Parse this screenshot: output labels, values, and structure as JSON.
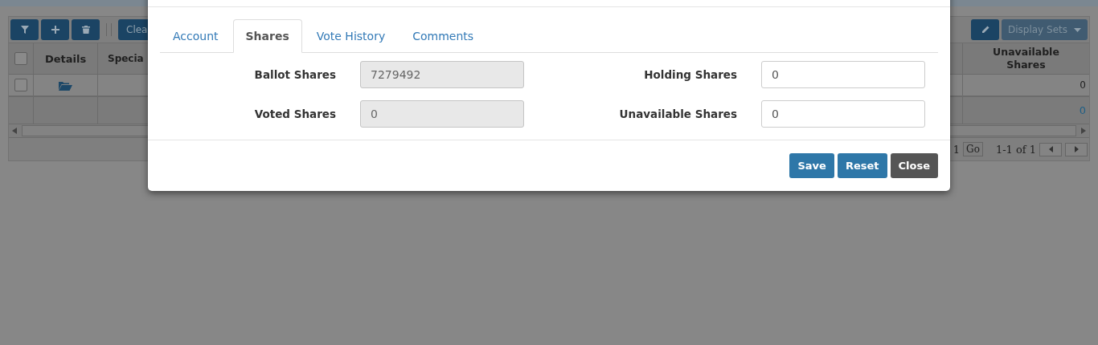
{
  "page": {
    "toolbar": {
      "icon_buttons": [
        {
          "kind": "filter"
        },
        {
          "kind": "add"
        },
        {
          "kind": "delete"
        }
      ],
      "clear_button": "Clea",
      "display_sets_button": "Display Sets"
    },
    "grid": {
      "select_all_checked": false,
      "columns": [
        "Details",
        "Specia",
        "Unavailable Shares"
      ],
      "rows": [
        {
          "checked": false,
          "unavailable_shares": "0"
        }
      ],
      "summary": {
        "unavailable_shares": "0"
      }
    },
    "pager": {
      "page": "1",
      "go_button": "Go",
      "range": "1-1 of 1"
    }
  },
  "dialog": {
    "tabs": [
      {
        "label": "Account",
        "selected": false
      },
      {
        "label": "Shares",
        "selected": true
      },
      {
        "label": "Vote History",
        "selected": false
      },
      {
        "label": "Comments",
        "selected": false
      }
    ],
    "fields": [
      {
        "label": "Ballot Shares",
        "value": "7279492",
        "disabled": true
      },
      {
        "label": "Holding Shares",
        "value": "0",
        "disabled": false
      },
      {
        "label": "Voted Shares",
        "value": "0",
        "disabled": true
      },
      {
        "label": "Unavailable Shares",
        "value": "0",
        "disabled": false
      }
    ],
    "buttons": [
      {
        "label": "Save",
        "kind": "primary"
      },
      {
        "label": "Reset",
        "kind": "primary"
      },
      {
        "label": "Close",
        "kind": "default"
      }
    ]
  }
}
